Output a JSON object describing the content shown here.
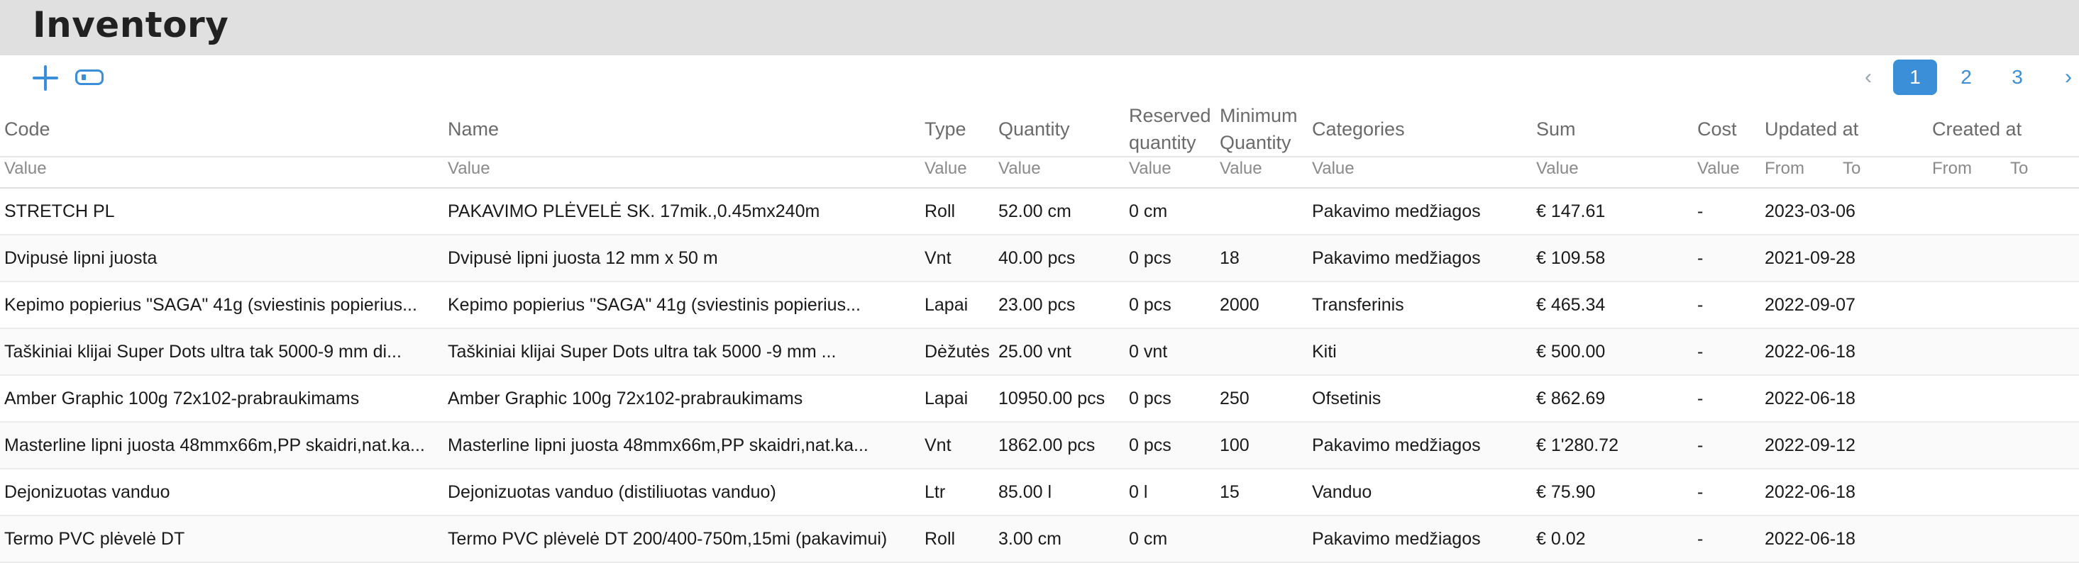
{
  "page": {
    "title": "Inventory"
  },
  "toolbar": {
    "add_icon": "plus-icon",
    "toggle_icon": "toggle-icon"
  },
  "pager": {
    "prev": "‹",
    "next": "›",
    "pages": [
      "1",
      "2",
      "3"
    ],
    "active": "1"
  },
  "columns": [
    "Code",
    "Name",
    "Type",
    "Quantity",
    "Reserved quantity",
    "Minimum Quantity",
    "Categories",
    "Sum",
    "Cost",
    "Updated at",
    "Created at"
  ],
  "filters": {
    "value": "Value",
    "from": "From",
    "to": "To"
  },
  "rows": [
    [
      "STRETCH PL",
      "PAKAVIMO PLĖVELĖ SK. 17mik.,0.45mx240m",
      "Roll",
      "52.00 cm",
      "0 cm",
      "",
      "Pakavimo medžiagos",
      "€ 147.61",
      "-",
      "2023-03-06",
      ""
    ],
    [
      "Dvipusė lipni juosta",
      "Dvipusė lipni juosta 12 mm x 50 m",
      "Vnt",
      "40.00 pcs",
      "0 pcs",
      "18",
      "Pakavimo medžiagos",
      "€ 109.58",
      "-",
      "2021-09-28",
      ""
    ],
    [
      "Kepimo popierius \"SAGA\" 41g (sviestinis popierius...",
      "Kepimo popierius \"SAGA\" 41g (sviestinis popierius...",
      "Lapai",
      "23.00 pcs",
      "0 pcs",
      "2000",
      "Transferinis",
      "€ 465.34",
      "-",
      "2022-09-07",
      ""
    ],
    [
      "Taškiniai klijai Super Dots ultra tak 5000-9 mm di...",
      "Taškiniai klijai Super Dots ultra tak 5000 -9 mm ...",
      "Dėžutės",
      "25.00 vnt",
      "0 vnt",
      "",
      "Kiti",
      "€ 500.00",
      "-",
      "2022-06-18",
      ""
    ],
    [
      "Amber Graphic 100g 72x102-prabraukimams",
      "Amber Graphic 100g 72x102-prabraukimams",
      "Lapai",
      "10950.00 pcs",
      "0 pcs",
      "250",
      "Ofsetinis",
      "€ 862.69",
      "-",
      "2022-06-18",
      ""
    ],
    [
      "Masterline lipni juosta 48mmx66m,PP skaidri,nat.ka...",
      "Masterline lipni juosta 48mmx66m,PP skaidri,nat.ka...",
      "Vnt",
      "1862.00 pcs",
      "0 pcs",
      "100",
      "Pakavimo medžiagos",
      "€ 1'280.72",
      "-",
      "2022-09-12",
      ""
    ],
    [
      "Dejonizuotas vanduo",
      "Dejonizuotas vanduo (distiliuotas vanduo)",
      "Ltr",
      "85.00 l",
      "0 l",
      "15",
      "Vanduo",
      "€ 75.90",
      "-",
      "2022-06-18",
      ""
    ],
    [
      "Termo PVC plėvelė DT",
      "Termo PVC plėvelė DT 200/400-750m,15mi (pakavimui)",
      "Roll",
      "3.00 cm",
      "0 cm",
      "",
      "Pakavimo medžiagos",
      "€ 0.02",
      "-",
      "2022-06-18",
      ""
    ]
  ]
}
